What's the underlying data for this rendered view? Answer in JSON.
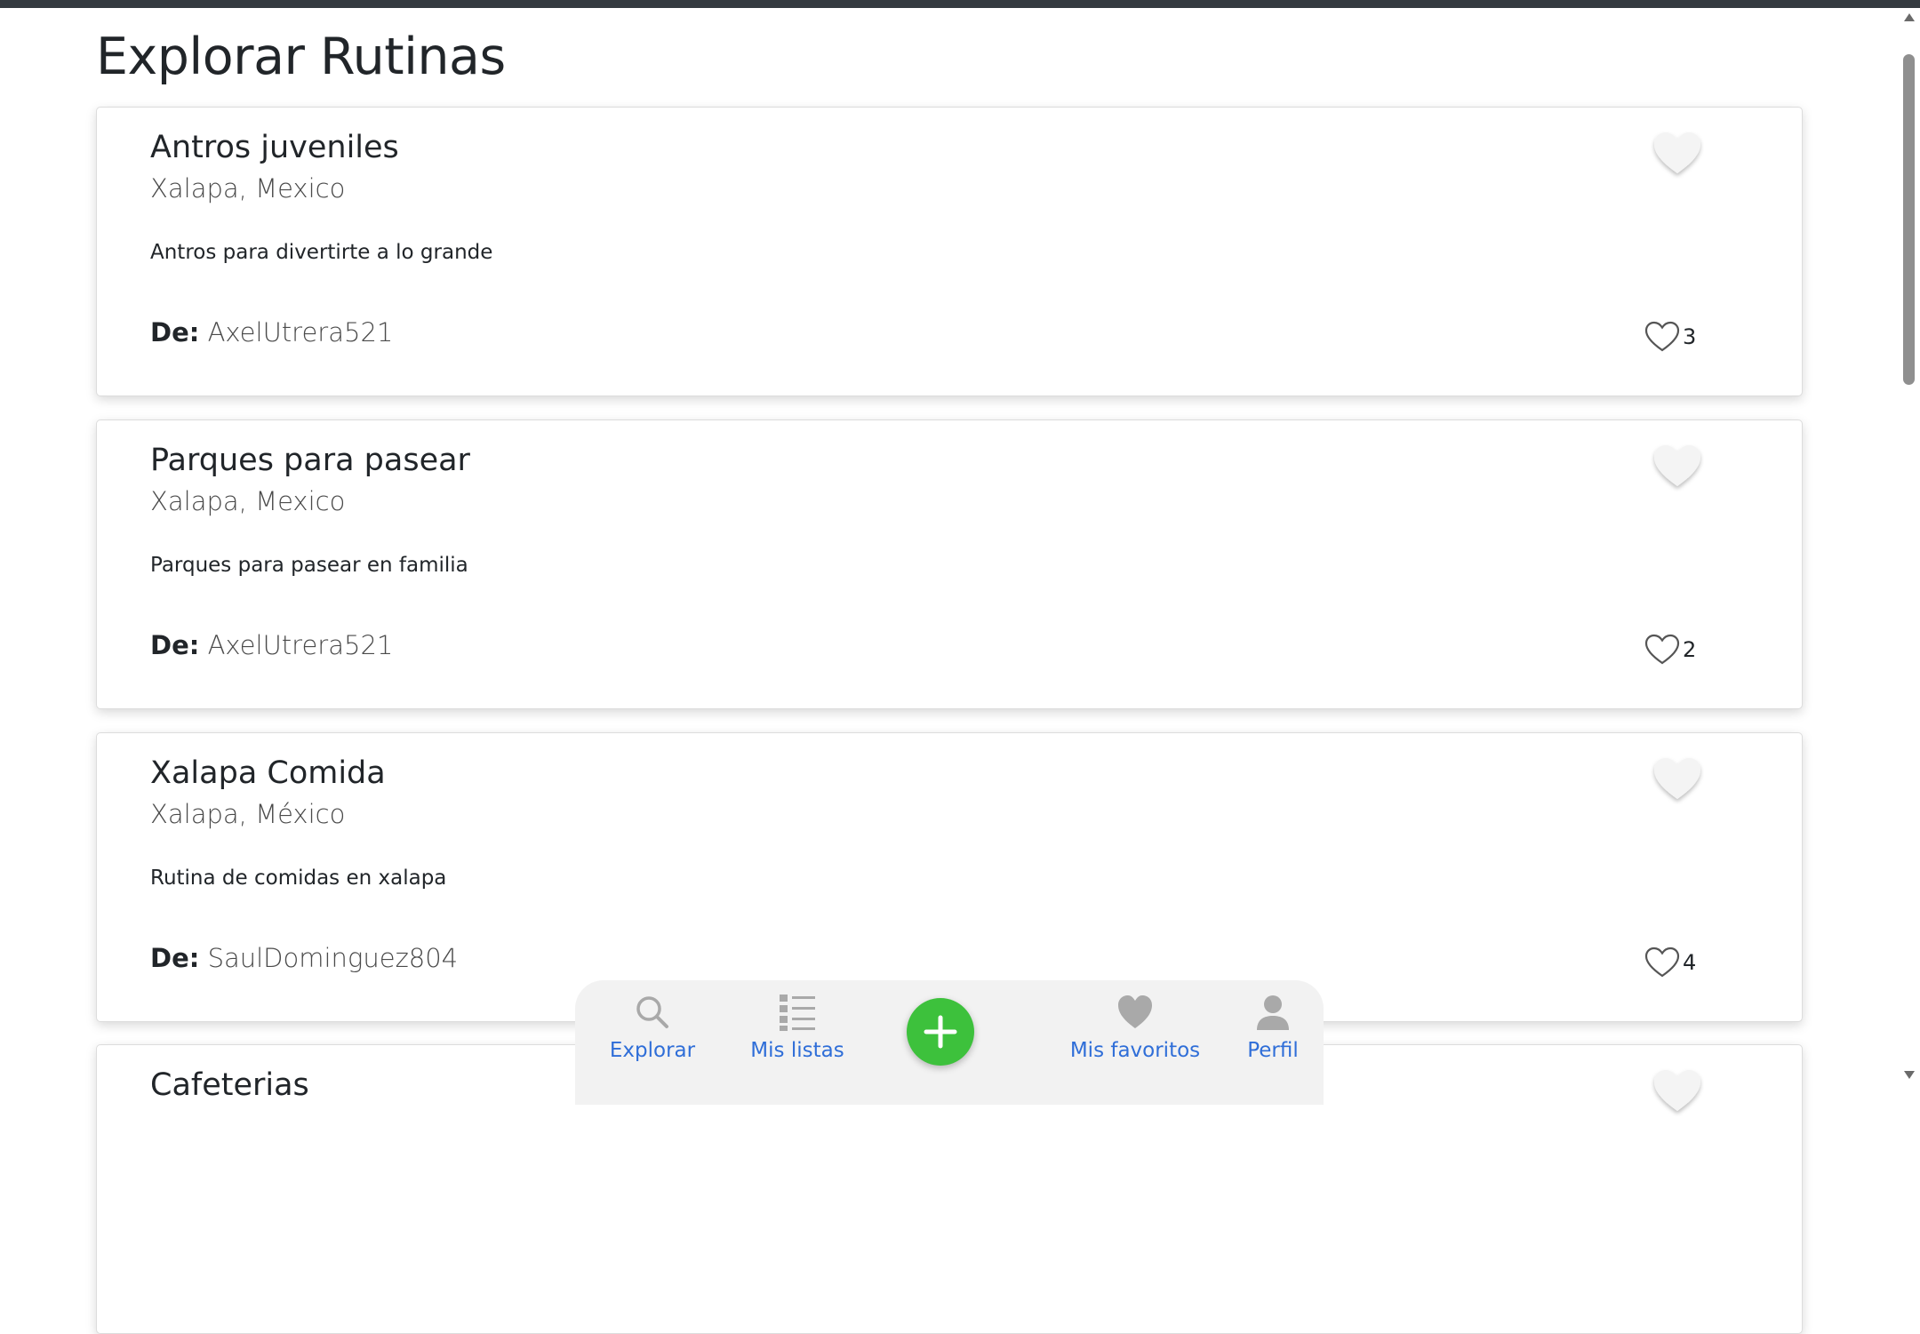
{
  "page": {
    "title": "Explorar Rutinas"
  },
  "routines": [
    {
      "title": "Antros juveniles",
      "location": "Xalapa, Mexico",
      "description": "Antros para divertirte a lo grande",
      "author_prefix": "De:",
      "author": "AxelUtrera521",
      "likes": "3"
    },
    {
      "title": "Parques para pasear",
      "location": "Xalapa, Mexico",
      "description": "Parques para pasear en familia",
      "author_prefix": "De:",
      "author": "AxelUtrera521",
      "likes": "2"
    },
    {
      "title": "Xalapa Comida",
      "location": "Xalapa, México",
      "description": "Rutina de comidas en xalapa",
      "author_prefix": "De:",
      "author": "SaulDominguez804",
      "likes": "4"
    },
    {
      "title": "Cafeterias",
      "location": "",
      "description": "",
      "author_prefix": "",
      "author": "",
      "likes": ""
    }
  ],
  "nav": {
    "explore_label": "Explorar",
    "lists_label": "Mis listas",
    "favorites_label": "Mis favoritos",
    "profile_label": "Perfil",
    "add_icon": "plus-icon"
  },
  "colors": {
    "nav_label": "#2f6ed8",
    "add_button": "#3dc13c",
    "nav_bg": "#f2f2f2",
    "top_bar": "#343a40"
  }
}
